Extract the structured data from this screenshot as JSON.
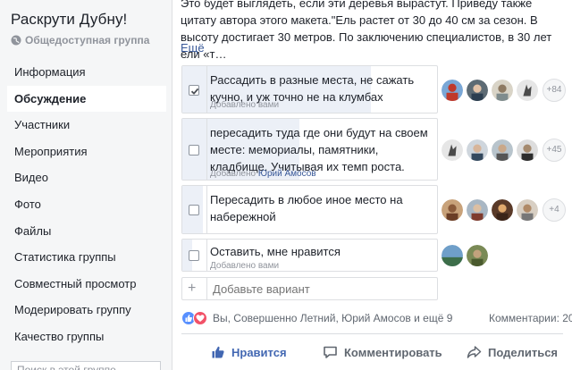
{
  "sidebar": {
    "group_name": "Раскрути Дубну!",
    "group_type": "Общедоступная группа",
    "items": [
      {
        "label": "Информация"
      },
      {
        "label": "Обсуждение"
      },
      {
        "label": "Участники"
      },
      {
        "label": "Мероприятия"
      },
      {
        "label": "Видео"
      },
      {
        "label": "Фото"
      },
      {
        "label": "Файлы"
      },
      {
        "label": "Статистика группы"
      },
      {
        "label": "Совместный просмотр"
      },
      {
        "label": "Модерировать группу"
      },
      {
        "label": "Качество группы"
      }
    ],
    "active_index": 1,
    "search_placeholder": "Поиск в этой группе"
  },
  "post": {
    "text": "Это будет выглядеть, если эти деревья вырастут. Приведу также цитату автора этого макета.\"Ель растет от 30 до 40 см за сезон. В высоту достигает 30 метров. По заключению специалистов, в 30 лет ели «т…",
    "see_more": "Ещё"
  },
  "poll": {
    "options": [
      {
        "text": "Рассадить в разные места, не сажать кучно, и уж точно не на клумбах",
        "added_prefix": "Добавлено вами",
        "added_author": "",
        "checked": true,
        "more_voters": "+84",
        "fill": 0.74
      },
      {
        "text": "пересадить туда где они будут на своем месте: мемориалы, памятники, кладбище. Учитывая их темп роста.",
        "added_prefix": "Добавлено",
        "added_author": "Юрий Амосов",
        "checked": false,
        "more_voters": "+45",
        "fill": 0.46
      },
      {
        "text": "Пересадить в любое иное место на набережной",
        "added_prefix": "",
        "added_author": "",
        "checked": false,
        "more_voters": "+4",
        "fill": 0.08
      },
      {
        "text": "Оставить, мне нравится",
        "added_prefix": "Добавлено вами",
        "added_author": "",
        "checked": false,
        "more_voters": "",
        "fill": 0.04
      }
    ],
    "add_placeholder": "Добавьте вариант"
  },
  "reactions": {
    "names": "Вы, Совершенно Летний, Юрий Амосов и ещё 9",
    "comments": "Комментарии: 20"
  },
  "actions": {
    "like": "Нравится",
    "comment": "Комментировать",
    "share": "Поделиться"
  },
  "colors": {
    "accent": "#4267b2",
    "link": "#385898",
    "love": "#f25268",
    "like": "#5890ff"
  }
}
